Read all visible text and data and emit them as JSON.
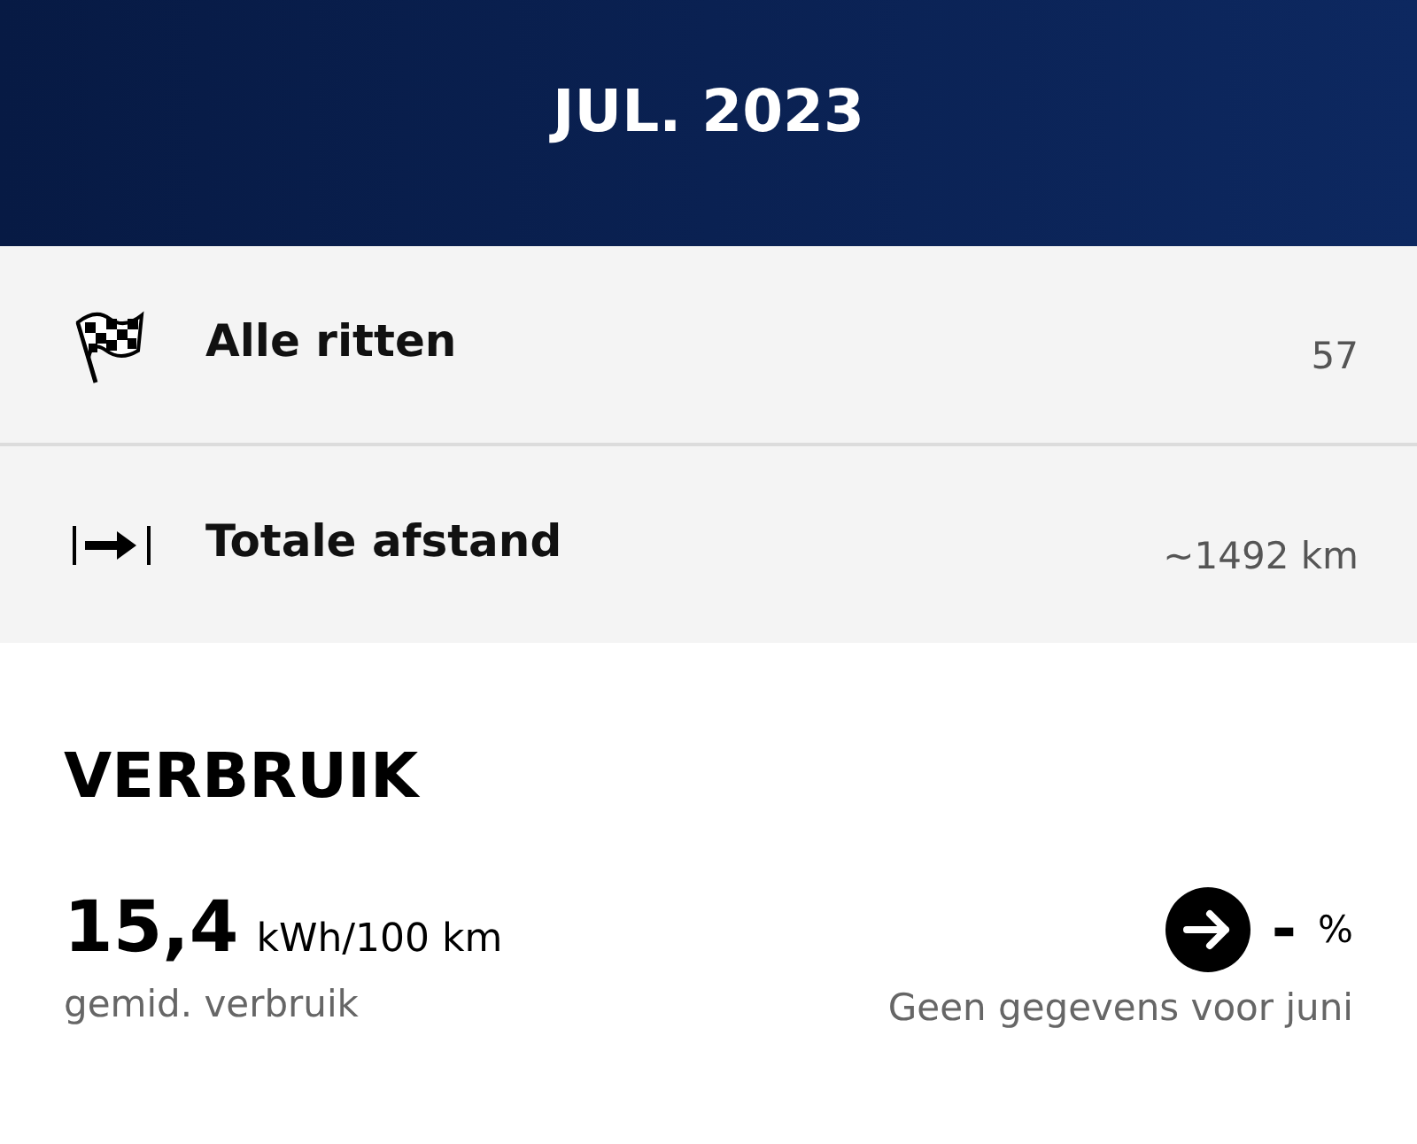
{
  "header": {
    "title": "JUL. 2023"
  },
  "rows": [
    {
      "kind": "flag",
      "label": "Alle ritten",
      "value": "57"
    },
    {
      "kind": "distance",
      "label": "Totale afstand",
      "value": "~1492 km"
    }
  ],
  "consumption": {
    "title": "VERBRUIK",
    "value": "15,4",
    "unit": "kWh/100 km",
    "caption": "gemid. verbruik",
    "trend": "-",
    "trend_unit": "%",
    "trend_caption": "Geen gegevens voor juni"
  }
}
